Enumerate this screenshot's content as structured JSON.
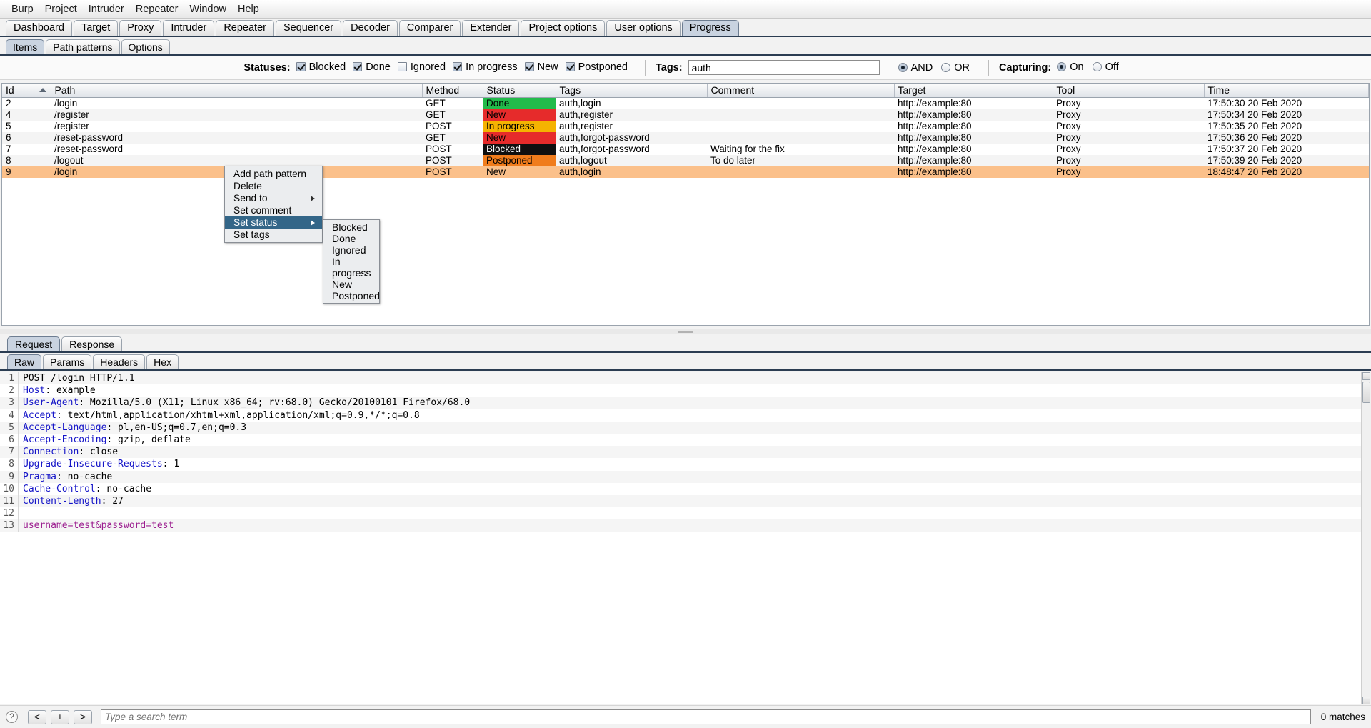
{
  "menubar": {
    "items": [
      "Burp",
      "Project",
      "Intruder",
      "Repeater",
      "Window",
      "Help"
    ]
  },
  "main_tabs": {
    "items": [
      "Dashboard",
      "Target",
      "Proxy",
      "Intruder",
      "Repeater",
      "Sequencer",
      "Decoder",
      "Comparer",
      "Extender",
      "Project options",
      "User options",
      "Progress"
    ],
    "active": "Progress"
  },
  "sub_tabs": {
    "items": [
      "Items",
      "Path patterns",
      "Options"
    ],
    "active": "Items"
  },
  "filter": {
    "statuses_label": "Statuses:",
    "statuses": [
      {
        "label": "Blocked",
        "checked": true
      },
      {
        "label": "Done",
        "checked": true
      },
      {
        "label": "Ignored",
        "checked": false
      },
      {
        "label": "In progress",
        "checked": true
      },
      {
        "label": "New",
        "checked": true
      },
      {
        "label": "Postponed",
        "checked": true
      }
    ],
    "tags_label": "Tags:",
    "tags_value": "auth",
    "tags_placeholder": "",
    "logic": [
      {
        "label": "AND",
        "selected": true
      },
      {
        "label": "OR",
        "selected": false
      }
    ],
    "capturing_label": "Capturing:",
    "capturing": [
      {
        "label": "On",
        "selected": true
      },
      {
        "label": "Off",
        "selected": false
      }
    ]
  },
  "table": {
    "columns": [
      "Id",
      "Path",
      "Method",
      "Status",
      "Tags",
      "Comment",
      "Target",
      "Tool",
      "Time"
    ],
    "sort_column": "Id",
    "sort_direction": "ascending",
    "rows": [
      {
        "id": "2",
        "path": "/login",
        "method": "GET",
        "status": "Done",
        "status_bg": "#22bb4b",
        "status_fg": "#000000",
        "tags": "auth,login",
        "comment": "",
        "target": "http://example:80",
        "tool": "Proxy",
        "time": "17:50:30 20 Feb 2020"
      },
      {
        "id": "4",
        "path": "/register",
        "method": "GET",
        "status": "New",
        "status_bg": "#e62b2b",
        "status_fg": "#000000",
        "tags": "auth,register",
        "comment": "",
        "target": "http://example:80",
        "tool": "Proxy",
        "time": "17:50:34 20 Feb 2020"
      },
      {
        "id": "5",
        "path": "/register",
        "method": "POST",
        "status": "In progress",
        "status_bg": "#f5b301",
        "status_fg": "#000000",
        "tags": "auth,register",
        "comment": "",
        "target": "http://example:80",
        "tool": "Proxy",
        "time": "17:50:35 20 Feb 2020"
      },
      {
        "id": "6",
        "path": "/reset-password",
        "method": "GET",
        "status": "New",
        "status_bg": "#e62b2b",
        "status_fg": "#000000",
        "tags": "auth,forgot-password",
        "comment": "",
        "target": "http://example:80",
        "tool": "Proxy",
        "time": "17:50:36 20 Feb 2020"
      },
      {
        "id": "7",
        "path": "/reset-password",
        "method": "POST",
        "status": "Blocked",
        "status_bg": "#100f0f",
        "status_fg": "#ffffff",
        "tags": "auth,forgot-password",
        "comment": "Waiting for the fix",
        "target": "http://example:80",
        "tool": "Proxy",
        "time": "17:50:37 20 Feb 2020"
      },
      {
        "id": "8",
        "path": "/logout",
        "method": "POST",
        "status": "Postponed",
        "status_bg": "#f07c1c",
        "status_fg": "#000000",
        "tags": "auth,logout",
        "comment": "To do later",
        "target": "http://example:80",
        "tool": "Proxy",
        "time": "17:50:39 20 Feb 2020"
      },
      {
        "id": "9",
        "path": "/login",
        "method": "POST",
        "status": "New",
        "status_bg": "transparent",
        "status_fg": "#000000",
        "tags": "auth,login",
        "comment": "",
        "target": "http://example:80",
        "tool": "Proxy",
        "time": "18:48:47 20 Feb 2020",
        "selected": true
      }
    ]
  },
  "context_menu": {
    "items": [
      {
        "label": "Add path pattern",
        "submenu": false,
        "highlighted": false
      },
      {
        "label": "Delete",
        "submenu": false,
        "highlighted": false
      },
      {
        "label": "Send to",
        "submenu": true,
        "highlighted": false
      },
      {
        "label": "Set comment",
        "submenu": false,
        "highlighted": false
      },
      {
        "label": "Set status",
        "submenu": true,
        "highlighted": true
      },
      {
        "label": "Set tags",
        "submenu": false,
        "highlighted": false
      }
    ],
    "submenu_items": [
      "Blocked",
      "Done",
      "Ignored",
      "In progress",
      "New",
      "Postponed"
    ]
  },
  "lower": {
    "msg_tabs": {
      "items": [
        "Request",
        "Response"
      ],
      "active": "Request"
    },
    "view_tabs": {
      "items": [
        "Raw",
        "Params",
        "Headers",
        "Hex"
      ],
      "active": "Raw"
    },
    "code_lines": [
      {
        "n": "1",
        "kind": "plain",
        "text": "POST /login HTTP/1.1"
      },
      {
        "n": "2",
        "kind": "header",
        "name": "Host",
        "value": " example"
      },
      {
        "n": "3",
        "kind": "header",
        "name": "User-Agent",
        "value": " Mozilla/5.0 (X11; Linux x86_64; rv:68.0) Gecko/20100101 Firefox/68.0"
      },
      {
        "n": "4",
        "kind": "header",
        "name": "Accept",
        "value": " text/html,application/xhtml+xml,application/xml;q=0.9,*/*;q=0.8"
      },
      {
        "n": "5",
        "kind": "header",
        "name": "Accept-Language",
        "value": " pl,en-US;q=0.7,en;q=0.3"
      },
      {
        "n": "6",
        "kind": "header",
        "name": "Accept-Encoding",
        "value": " gzip, deflate"
      },
      {
        "n": "7",
        "kind": "header",
        "name": "Connection",
        "value": " close"
      },
      {
        "n": "8",
        "kind": "header",
        "name": "Upgrade-Insecure-Requests",
        "value": " 1"
      },
      {
        "n": "9",
        "kind": "header",
        "name": "Pragma",
        "value": " no-cache"
      },
      {
        "n": "10",
        "kind": "header",
        "name": "Cache-Control",
        "value": " no-cache"
      },
      {
        "n": "11",
        "kind": "header",
        "name": "Content-Length",
        "value": " 27"
      },
      {
        "n": "12",
        "kind": "plain",
        "text": ""
      },
      {
        "n": "13",
        "kind": "body",
        "text": "username=test&password=test"
      }
    ]
  },
  "bottombar": {
    "help_glyph": "?",
    "prev_label": "<",
    "add_label": "+",
    "next_label": ">",
    "search_placeholder": "Type a search term",
    "search_value": "",
    "matches": "0 matches"
  }
}
